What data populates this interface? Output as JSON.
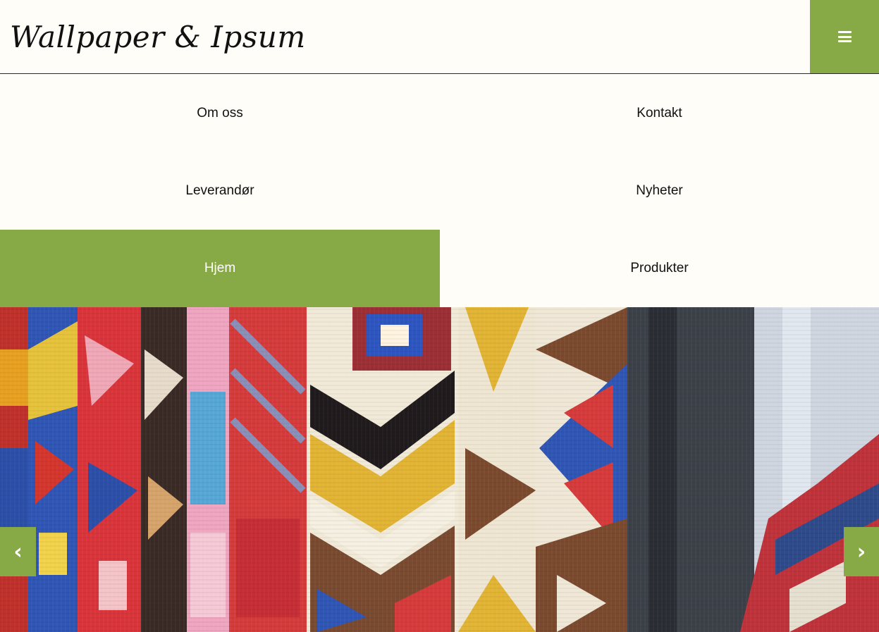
{
  "header": {
    "logo_text": "Wallpaper & Ipsum",
    "menu_icon": "hamburger-icon",
    "accent_color": "#88aa46"
  },
  "nav": {
    "items": [
      {
        "label": "Om oss",
        "active": false
      },
      {
        "label": "Kontakt",
        "active": false
      },
      {
        "label": "Leverandør",
        "active": false
      },
      {
        "label": "Nyheter",
        "active": false
      },
      {
        "label": "Hjem",
        "active": true
      },
      {
        "label": "Produkter",
        "active": false
      }
    ]
  },
  "slider": {
    "prev_label": "‹",
    "next_label": "›",
    "prev_icon": "chevron-left-icon",
    "next_icon": "chevron-right-icon"
  }
}
